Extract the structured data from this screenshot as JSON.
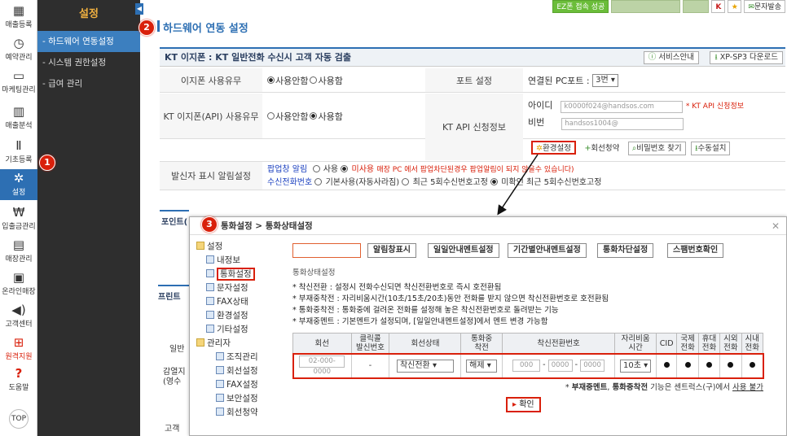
{
  "iconbar": {
    "items": [
      {
        "label": "매출등록",
        "icon": "calculator-icon",
        "glyph": "▦"
      },
      {
        "label": "예약관리",
        "icon": "clock-icon",
        "glyph": "◷"
      },
      {
        "label": "마케팅관리",
        "icon": "monitor-icon",
        "glyph": "▭"
      },
      {
        "label": "매출분석",
        "icon": "bar-chart-icon",
        "glyph": "▥"
      },
      {
        "label": "기초등록",
        "icon": "pen-icon",
        "glyph": "Ⅱ"
      },
      {
        "label": "설정",
        "icon": "gear-icon",
        "glyph": "✲"
      },
      {
        "label": "입출금관리",
        "icon": "won-icon",
        "glyph": "₩"
      },
      {
        "label": "매장관리",
        "icon": "store-icon",
        "glyph": "▤"
      },
      {
        "label": "온라인매장",
        "icon": "online-store-icon",
        "glyph": "▣"
      },
      {
        "label": "고객센터",
        "icon": "speaker-icon",
        "glyph": "◀)"
      },
      {
        "label": "원격지원",
        "icon": "remote-icon",
        "glyph": "⊞"
      },
      {
        "label": "도움말",
        "icon": "help-icon",
        "glyph": "?"
      },
      {
        "label": "TOP",
        "icon": "top-icon",
        "glyph": "▲"
      }
    ]
  },
  "sidebar": {
    "title": "설정",
    "items": [
      "하드웨어 연동설정",
      "시스템 권한설정",
      "급여 관리"
    ]
  },
  "topbar": {
    "ez_status": "EZ폰 접속 성공",
    "sms_label": "문자발송"
  },
  "page": {
    "title": "하드웨어 연동 설정"
  },
  "badges": [
    "1",
    "2",
    "3"
  ],
  "panel": {
    "title": "KT 이지폰 : KT 일반전화 수신시 고객 자동 검출",
    "service_btn": "서비스안내",
    "xp_btn": "XP-SP3 다운로드",
    "rows": {
      "use_label": "이지폰 사용유무",
      "use_opt1": "사용안함",
      "use_opt2": "사용함",
      "port_label": "포트 설정",
      "port_text": "연결된 PC포트 :",
      "port_value": "3번",
      "api_label": "KT 이지폰(API) 사용유무",
      "api_opt1": "사용안함",
      "api_opt2": "사용함",
      "kt_api_label": "KT API 신청정보",
      "id_label": "아이디",
      "id_value": "k0000f024@handsos.com",
      "id_note": "* KT API 신청정보",
      "pw_label": "비번",
      "pw_value": "handsos1004@",
      "btn_env": "환경설정",
      "btn_apply": "회선청약",
      "btn_pw": "비밀번호 찾기",
      "btn_manual": "수동설치",
      "caller_label": "발신자 표시 알림설정",
      "popup_label": "팝업창 알림",
      "popup_opt1": "사용",
      "popup_opt2": "미사용",
      "popup_note": "매장 PC 에서 팝업차단된경우 팝업알림이 되지 않을수 있습니다)",
      "recv_label": "수신전화번호",
      "recv_opt1": "기본사용(자동사라짐)",
      "recv_opt2": "최근 5회수신번호고정",
      "recv_opt3": "미확인 최근 5회수신번호고정"
    }
  },
  "under_labels": [
    "포인트(",
    "프린트 ",
    "일반",
    "감열지\n(영수",
    "고객"
  ],
  "dialog": {
    "title": "통화설정 > 통화상태설정",
    "tree": [
      {
        "label": "설정",
        "level": 0,
        "kind": "folder"
      },
      {
        "label": "내정보",
        "level": 1,
        "kind": "page"
      },
      {
        "label": "통화설정",
        "level": 1,
        "kind": "page"
      },
      {
        "label": "문자설정",
        "level": 1,
        "kind": "page"
      },
      {
        "label": "FAX상태",
        "level": 1,
        "kind": "page"
      },
      {
        "label": "환경설정",
        "level": 1,
        "kind": "page"
      },
      {
        "label": "기타설정",
        "level": 1,
        "kind": "page"
      },
      {
        "label": "관리자",
        "level": 0,
        "kind": "folder"
      },
      {
        "label": "조직관리",
        "level": 2,
        "kind": "page"
      },
      {
        "label": "회선설정",
        "level": 2,
        "kind": "page"
      },
      {
        "label": "FAX설정",
        "level": 2,
        "kind": "page"
      },
      {
        "label": "보안설정",
        "level": 2,
        "kind": "page"
      },
      {
        "label": "회선청약",
        "level": 2,
        "kind": "page"
      }
    ],
    "tabs": [
      "알림창표시",
      "일일안내멘트설정",
      "기간별안내멘트설정",
      "통화차단설정",
      "스팸번호확인"
    ],
    "section_title": "통화상태설정",
    "notes": [
      "* 착신전환 : 설정시 전화수신되면 착신전환번호로 즉시 호전환됨",
      "* 부재중착전 : 자리비움시간(10초/15초/20초)동안 전화를 받지 않으면 착신전환번호로 호전환됨",
      "* 통화중착전 : 통화중에 걸려온 전화를 설정해 놓은 착신전환번호로 돌려받는 기능",
      "* 부재중멘트 : 기본멘트가 설정되며, [일일안내멘트설정]에서 멘트 변경 가능함"
    ],
    "table": {
      "headers": [
        "회선",
        "클릭콜\n발신번호",
        "회선상태",
        "통화중\n착전",
        "착신전환번호",
        "자리비움\n시간",
        "CID",
        "국제\n전화",
        "휴대\n전화",
        "시외\n전화",
        "시내\n전화"
      ],
      "row": {
        "line": "02-000-0000",
        "click": "-",
        "status": "착신전환",
        "busy": "해제",
        "fwd1": "000",
        "fwd2": "0000",
        "fwd3": "0000",
        "away": "10초"
      }
    },
    "foot_pre": "* ",
    "foot_b1": "부재중멘트",
    "foot_mid": ", ",
    "foot_b2": "통화중착전",
    "foot_post": " 기능은 센트럭스(구)에서 ",
    "foot_u": "사용 불가",
    "confirm": "확인"
  }
}
